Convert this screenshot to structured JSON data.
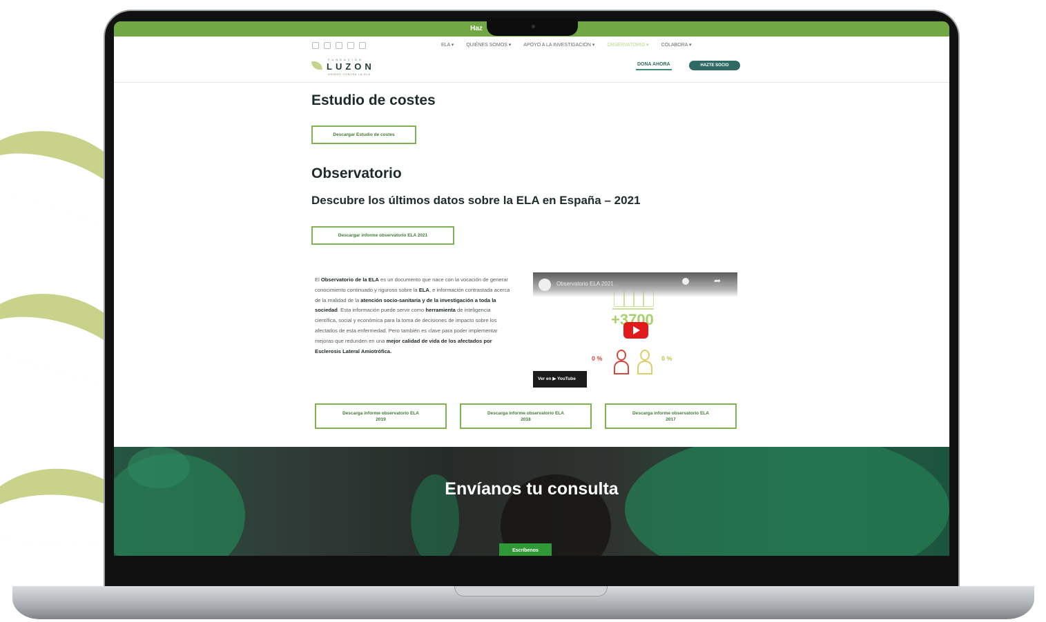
{
  "topbar": {
    "text": "Haz"
  },
  "nav": {
    "menu": [
      "ELA ▾",
      "QUIÉNES SOMOS ▾",
      "APOYO A LA INVESTIGACIÓN ▾",
      "OBSERVATORIO ▾",
      "COLABORA ▾"
    ],
    "donate_label": "DONA AHORA",
    "member_label": "HAZTE SOCIO"
  },
  "logo": {
    "small": "FUNDACIÓN",
    "name": "LUZON",
    "tag": "UNIDOS CONTRA LA ELA"
  },
  "costes": {
    "heading": "Estudio de costes",
    "button": "Descargar Estudio de costes"
  },
  "observatorio": {
    "heading": "Observatorio",
    "subheading": "Descubre los últimos datos sobre la ELA en España – 2021",
    "button": "Descargar informe observatorio ELA 2021",
    "paragraph": {
      "p0": "El ",
      "b0": "Observatorio de la ELA",
      "p1": " es un documento que nace con la vocación de generar conocimiento continuado y riguroso sobre la ",
      "b1": "ELA",
      "p2": ", e información contrastada acerca de la realidad de la ",
      "b2": "atención socio-sanitaria y de la investigación a toda la sociedad",
      "p3": ". Esta información puede servir como ",
      "b3": "herramienta",
      "p4": " de inteligencia científica, social y económica para la toma de decisiones de impacto sobre los afectados de esta enfermedad. Pero también es clave para poder implementar mejoras que redunden en una ",
      "b4": "mejor calidad de vida de los afectados por Esclerosis Lateral Amiotrófica."
    },
    "video": {
      "title": "Observatorio ELA 2021",
      "stat": "+3700",
      "p1": "0 %",
      "p2": "0 %",
      "watch_label": "Ver en  ▶ YouTube"
    },
    "downloads": [
      {
        "line1": "Descarga informe observatorio ELA",
        "line2": "2019"
      },
      {
        "line1": "Descarga informe observatorio ELA",
        "line2": "2018"
      },
      {
        "line1": "Descarga informe observatorio ELA",
        "line2": "2017"
      }
    ]
  },
  "contact": {
    "heading": "Envíanos tu consulta",
    "button": "Escríbenos"
  },
  "colors": {
    "brand_green": "#72a844",
    "dark_teal": "#2f6b64",
    "accent_light": "#c9e19c",
    "swoosh": "#c9d28a"
  }
}
